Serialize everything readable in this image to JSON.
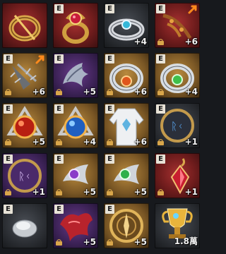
{
  "grid": {
    "items": [
      {
        "name": "gold-ring-icon",
        "grade": "",
        "level": "",
        "count": "",
        "bg": "red",
        "locked": false,
        "upgrade": false
      },
      {
        "name": "ruby-ring-icon",
        "grade": "E",
        "level": "",
        "count": "",
        "bg": "red",
        "locked": false,
        "upgrade": false
      },
      {
        "name": "silver-ring-icon",
        "grade": "E",
        "level": "+4",
        "count": "",
        "bg": "dark",
        "locked": false,
        "upgrade": false
      },
      {
        "name": "lizard-necklace-icon",
        "grade": "E",
        "level": "+6",
        "count": "",
        "bg": "red",
        "locked": true,
        "upgrade": true
      },
      {
        "name": "spiked-necklace-icon",
        "grade": "E",
        "level": "+6",
        "count": "",
        "bg": "gold",
        "locked": true,
        "upgrade": true
      },
      {
        "name": "dragon-necklace-icon",
        "grade": "E",
        "level": "+5",
        "count": "",
        "bg": "purple",
        "locked": true,
        "upgrade": false
      },
      {
        "name": "orange-gem-bracelet-icon",
        "grade": "E",
        "level": "+6",
        "count": "",
        "bg": "gold",
        "locked": true,
        "upgrade": false
      },
      {
        "name": "green-gem-bracelet-icon",
        "grade": "E",
        "level": "+4",
        "count": "",
        "bg": "gold",
        "locked": true,
        "upgrade": false
      },
      {
        "name": "red-orb-amulet-icon",
        "grade": "E",
        "level": "+5",
        "count": "",
        "bg": "gold",
        "locked": true,
        "upgrade": false
      },
      {
        "name": "blue-orb-amulet-icon",
        "grade": "E",
        "level": "+4",
        "count": "",
        "bg": "gold",
        "locked": true,
        "upgrade": false
      },
      {
        "name": "white-robe-icon",
        "grade": "E",
        "level": "+6",
        "count": "",
        "bg": "gold",
        "locked": true,
        "upgrade": false
      },
      {
        "name": "blue-rune-tablet-icon",
        "grade": "E",
        "level": "+1",
        "count": "",
        "bg": "dark",
        "locked": true,
        "upgrade": false
      },
      {
        "name": "purple-rune-tablet-icon",
        "grade": "E",
        "level": "+1",
        "count": "",
        "bg": "purple",
        "locked": true,
        "upgrade": false
      },
      {
        "name": "purple-gem-earring-icon",
        "grade": "E",
        "level": "+5",
        "count": "",
        "bg": "gold",
        "locked": true,
        "upgrade": false
      },
      {
        "name": "green-gem-earring-icon",
        "grade": "E",
        "level": "+5",
        "count": "",
        "bg": "gold",
        "locked": true,
        "upgrade": false
      },
      {
        "name": "ruby-pendant-icon",
        "grade": "E",
        "level": "+1",
        "count": "",
        "bg": "red",
        "locked": true,
        "upgrade": false
      },
      {
        "name": "silver-stone-icon",
        "grade": "E",
        "level": "",
        "count": "",
        "bg": "dark",
        "locked": false,
        "upgrade": false
      },
      {
        "name": "red-mask-icon",
        "grade": "E",
        "level": "+5",
        "count": "",
        "bg": "purple",
        "locked": true,
        "upgrade": false
      },
      {
        "name": "golden-compass-icon",
        "grade": "E",
        "level": "+5",
        "count": "",
        "bg": "gold",
        "locked": true,
        "upgrade": false
      },
      {
        "name": "trophy-cup-icon",
        "grade": "",
        "level": "",
        "count": "1.8萬",
        "bg": "dark",
        "locked": false,
        "upgrade": false
      }
    ]
  }
}
